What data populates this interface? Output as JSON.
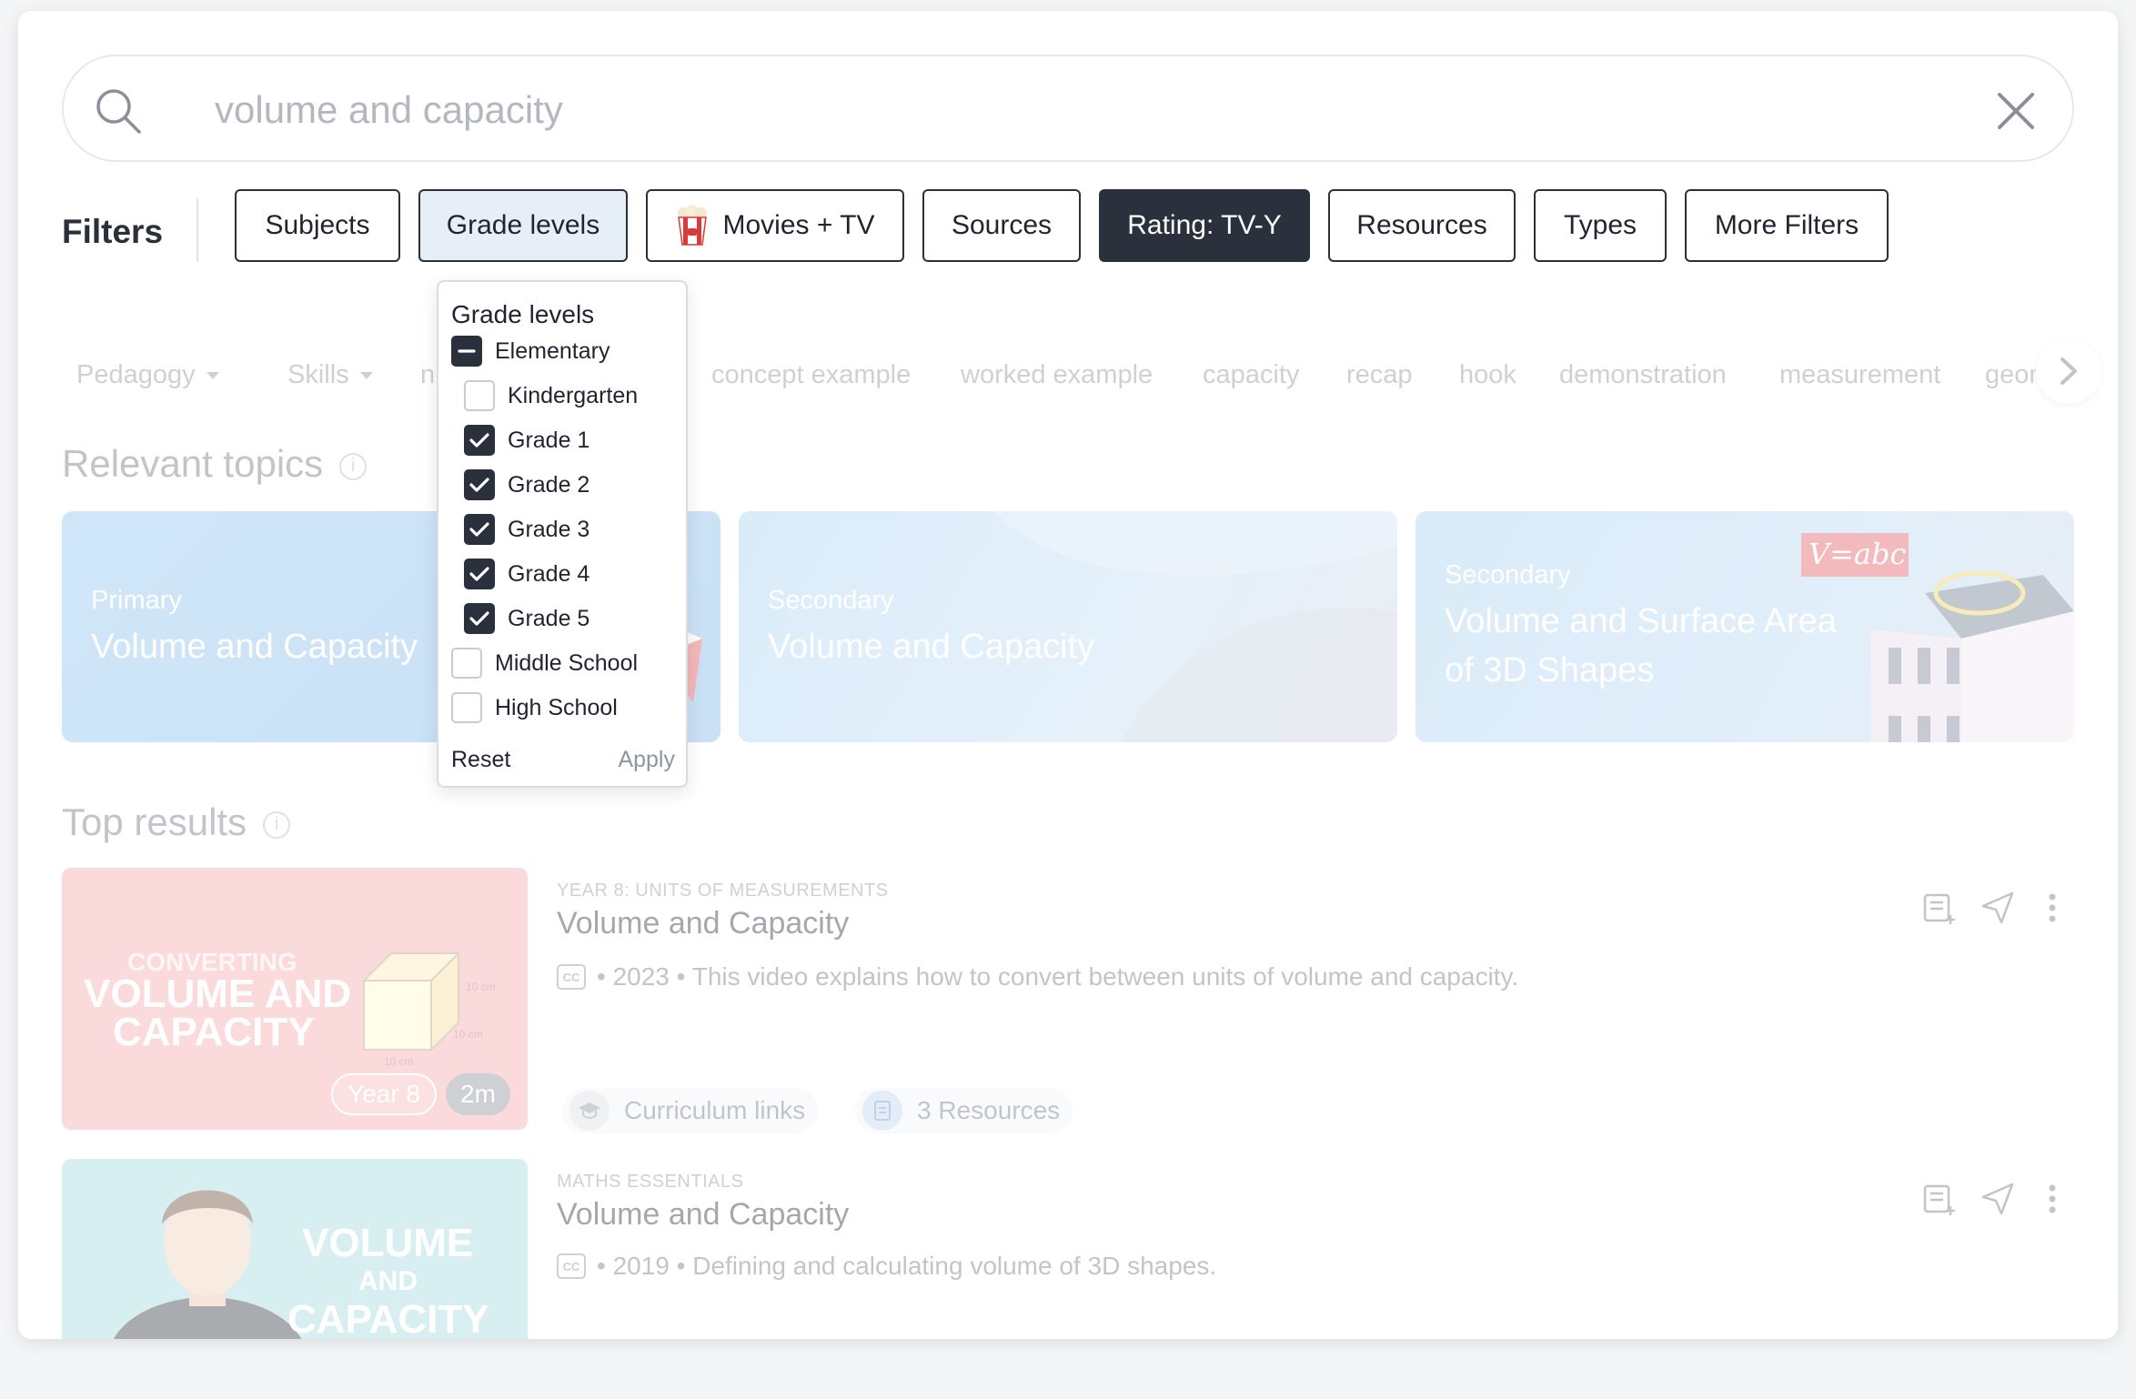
{
  "search": {
    "query": "volume and capacity"
  },
  "filters": {
    "label": "Filters",
    "chips": [
      "Subjects",
      "Grade levels",
      "Movies + TV",
      "Sources",
      "Rating: TV-Y",
      "Resources",
      "Types",
      "More Filters"
    ]
  },
  "tags": [
    "Pedagogy",
    "Skills",
    "n",
    "concept example",
    "worked example",
    "capacity",
    "recap",
    "hook",
    "demonstration",
    "measurement",
    "geom"
  ],
  "relevant_topics": {
    "title": "Relevant topics",
    "cards": [
      {
        "level": "Primary",
        "title": "Volume and Capacity"
      },
      {
        "level": "Secondary",
        "title": "Volume and Capacity"
      },
      {
        "level": "Secondary",
        "title_line1": "Volume and Surface Area",
        "title_line2": "of 3D Shapes",
        "badge": "V=abc"
      }
    ]
  },
  "top_results": {
    "title": "Top results",
    "items": [
      {
        "series": "YEAR 8: UNITS OF MEASUREMENTS",
        "title": "Volume and Capacity",
        "cc": "CC",
        "description": "• 2023 • This video explains how to convert between units of volume and capacity.",
        "thumb_line1": "CONVERTING",
        "thumb_line2": "VOLUME AND",
        "thumb_line3": "CAPACITY",
        "dim_label": "10 cm",
        "badge_year": "Year 8",
        "badge_duration": "2m",
        "curriculum_label": "Curriculum links",
        "resources_label": "3 Resources"
      },
      {
        "series": "MATHS ESSENTIALS",
        "title": "Volume and Capacity",
        "cc": "CC",
        "description": "• 2019 • Defining and calculating volume of 3D shapes.",
        "thumb_line1": "VOLUME",
        "thumb_line2": "AND",
        "thumb_line3": "CAPACITY"
      }
    ]
  },
  "grade_dropdown": {
    "title": "Grade levels",
    "options": [
      {
        "label": "Elementary",
        "state": "partial"
      },
      {
        "label": "Kindergarten",
        "state": "unchecked"
      },
      {
        "label": "Grade 1",
        "state": "checked"
      },
      {
        "label": "Grade 2",
        "state": "checked"
      },
      {
        "label": "Grade 3",
        "state": "checked"
      },
      {
        "label": "Grade 4",
        "state": "checked"
      },
      {
        "label": "Grade 5",
        "state": "checked"
      },
      {
        "label": "Middle School",
        "state": "unchecked"
      },
      {
        "label": "High School",
        "state": "unchecked"
      }
    ],
    "reset": "Reset",
    "apply": "Apply"
  },
  "colors": {
    "accent_dark": "#2b303d",
    "active_chip": "#e6eef8",
    "topic_blue": "#8ec3ee"
  }
}
